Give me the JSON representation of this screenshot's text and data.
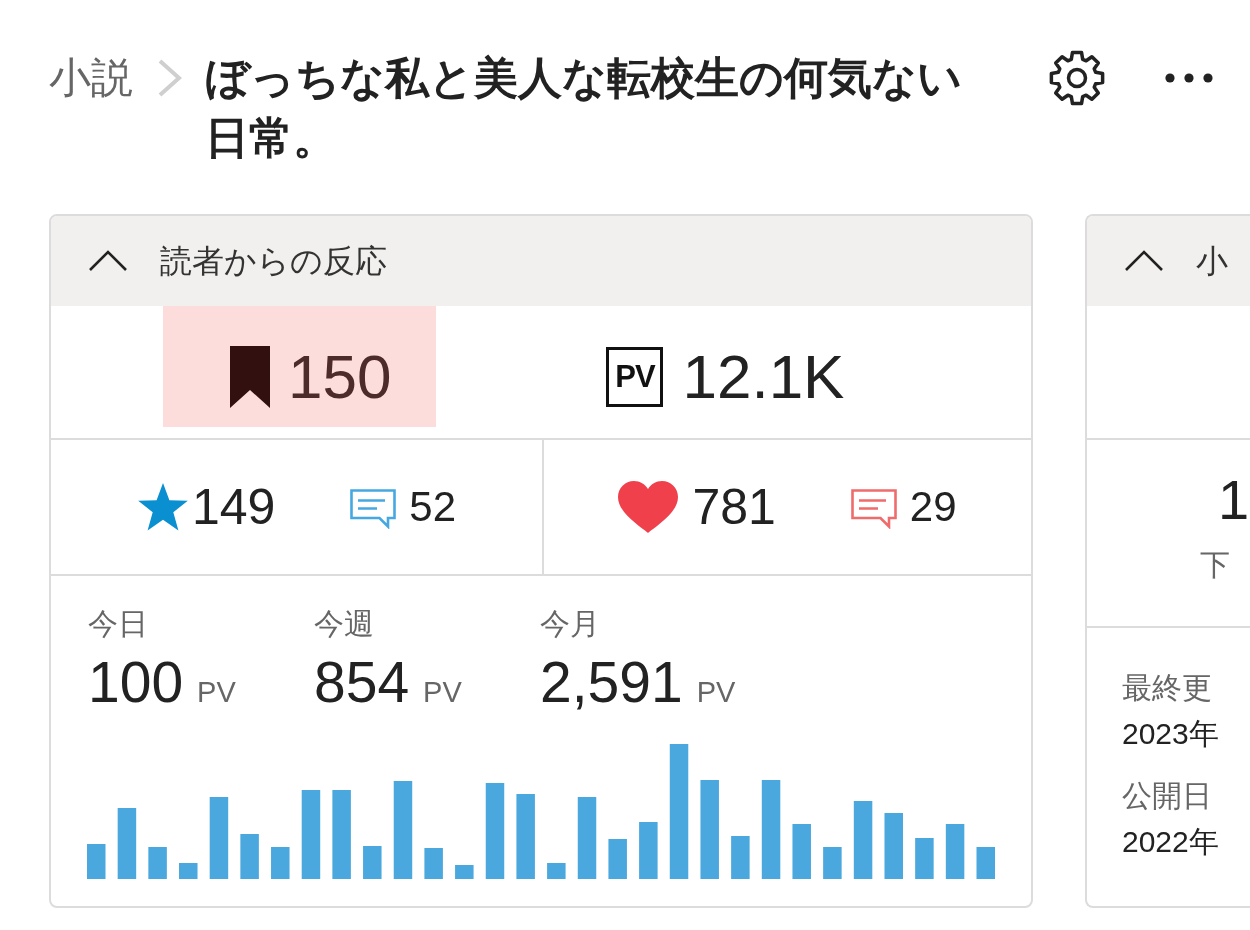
{
  "breadcrumb": {
    "parent": "小説",
    "title": "ぼっちな私と美人な転校生の何気ない日常。"
  },
  "panels": [
    {
      "title": "読者からの反応",
      "expanded": true,
      "headline_stats": [
        {
          "kind": "bookmarks",
          "value": "150",
          "highlighted": true
        },
        {
          "kind": "pv",
          "symbol": "PV",
          "value": "12.1K",
          "highlighted": false
        }
      ],
      "reaction_groups": [
        {
          "stats": [
            {
              "kind": "star",
              "value": "149",
              "color": "#0a8fd0"
            },
            {
              "kind": "comment",
              "value": "52",
              "color": "#45a8e2"
            }
          ]
        },
        {
          "stats": [
            {
              "kind": "heart",
              "value": "781",
              "color": "#f0404c"
            },
            {
              "kind": "comment",
              "value": "29",
              "color": "#f06b6b"
            }
          ]
        }
      ],
      "pv_periods": [
        {
          "label": "今日",
          "value": "100",
          "unit": "PV"
        },
        {
          "label": "今週",
          "value": "854",
          "unit": "PV"
        },
        {
          "label": "今月",
          "value": "2,591",
          "unit": "PV"
        }
      ]
    },
    {
      "title": "小",
      "expanded": true,
      "count": {
        "value": "1",
        "label": "下"
      },
      "dates": [
        {
          "label": "最終更",
          "value": "2023年"
        },
        {
          "label": "公開日",
          "value": "2022年"
        }
      ]
    }
  ]
}
